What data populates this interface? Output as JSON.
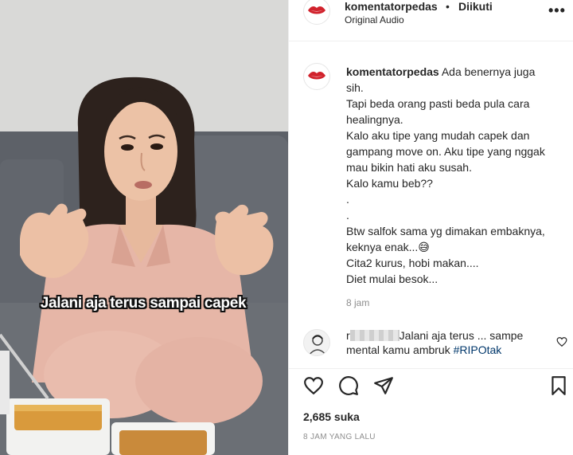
{
  "video": {
    "caption_overlay": "Jalani aja terus sampai capek"
  },
  "header": {
    "username": "komentatorpedas",
    "separator": "•",
    "follow_status": "Diikuti",
    "audio_label": "Original Audio",
    "more_icon": "more-horizontal-icon"
  },
  "caption": {
    "username": "komentatorpedas",
    "lines": [
      "Ada benernya juga",
      "sih.",
      "Tapi beda orang pasti beda pula cara",
      "healingnya.",
      "Kalo aku tipe yang mudah capek dan",
      "gampang move on. Aku tipe yang nggak",
      "mau bikin hati aku susah.",
      "Kalo kamu beb??",
      ".",
      ".",
      "Btw salfok sama yg dimakan embaknya,",
      "keknya enak...😅",
      "Cita2 kurus, hobi makan....",
      "Diet mulai besok..."
    ],
    "time": "8 jam"
  },
  "comment": {
    "username_prefix": "r",
    "text_1": "Jalani aja terus ... sampe",
    "text_2": "mental kamu ambruk",
    "hashtag": "#RIPOtak"
  },
  "actions": {
    "likes": "2,685 suka",
    "posted_ago": "8 JAM YANG LALU",
    "icons": [
      "heart-icon",
      "comment-icon",
      "share-icon",
      "bookmark-icon"
    ]
  },
  "colors": {
    "text": "#262626",
    "secondary": "#8e8e8e",
    "link": "#00376b",
    "border": "#efefef"
  }
}
